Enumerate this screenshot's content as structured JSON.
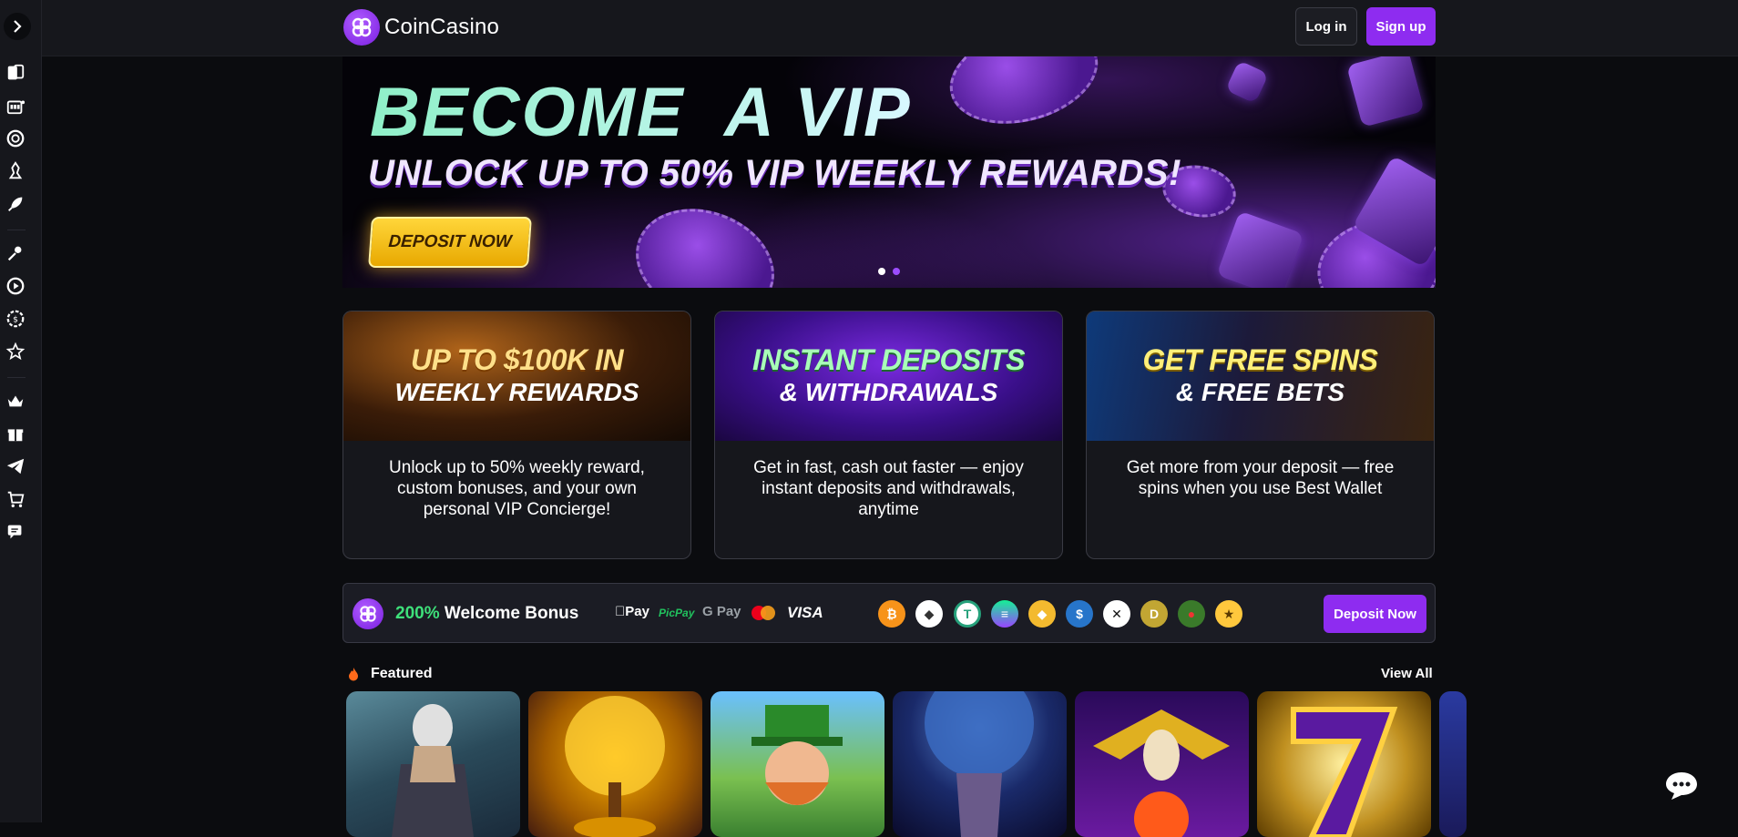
{
  "header": {
    "brand": "CoinCasino",
    "login_label": "Log in",
    "signup_label": "Sign up"
  },
  "sidebar": {
    "icons": [
      "cards-icon",
      "slot-machine-icon",
      "roulette-icon",
      "poker-chip-icon",
      "rocket-icon",
      "sports-icon",
      "live-play-icon",
      "casino-chip-icon",
      "star-icon",
      "vip-crown-icon",
      "gift-icon",
      "telegram-icon",
      "shopping-cart-icon",
      "support-chat-icon"
    ]
  },
  "hero": {
    "title": "BECOME  A VIP",
    "subtitle": "UNLOCK UP TO 50% VIP WEEKLY REWARDS!",
    "cta": "DEPOSIT NOW",
    "slides": 2,
    "active_slide": 2
  },
  "promos": [
    {
      "head1": "UP TO $100K IN",
      "head2": "WEEKLY REWARDS",
      "description": "Unlock up to 50% weekly reward, custom bonuses, and your own personal VIP Concierge!"
    },
    {
      "head1": "INSTANT DEPOSITS",
      "head2": "& WITHDRAWALS",
      "description": "Get in fast, cash out faster — enjoy instant deposits and withdrawals, anytime"
    },
    {
      "head1": "GET FREE SPINS",
      "head2": "& FREE BETS",
      "description": "Get more from your deposit — free spins when you use Best Wallet"
    }
  ],
  "welcome": {
    "percent": "200%",
    "label": "Welcome Bonus",
    "payments": [
      "Pay",
      "PicPay",
      "G Pay",
      "VISA"
    ],
    "cta": "Deposit Now"
  },
  "featured": {
    "title": "Featured",
    "view_all": "View All"
  },
  "colors": {
    "accent": "#8e2cf0",
    "bonus_green": "#3ee07a",
    "background": "#0b0c0f",
    "panel": "#16171c"
  }
}
